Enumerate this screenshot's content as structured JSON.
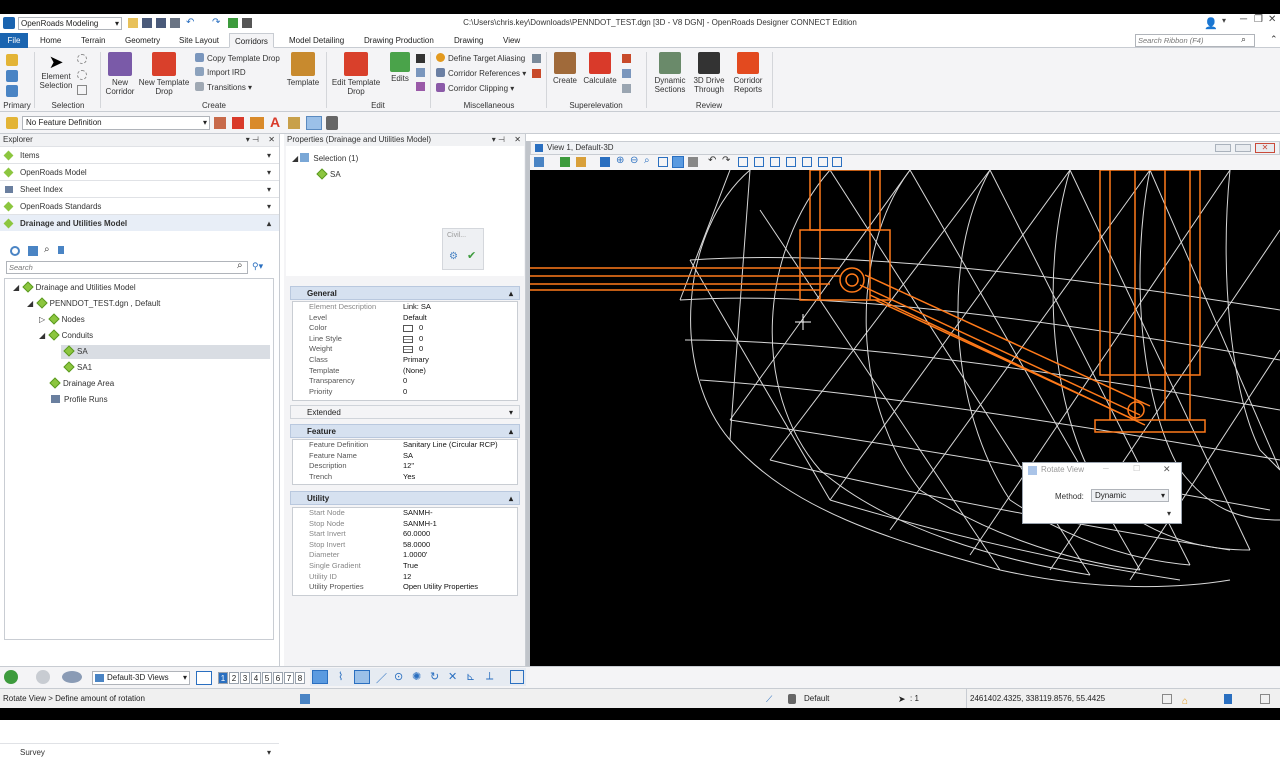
{
  "app": {
    "title": "C:\\Users\\chris.key\\Downloads\\PENNDOT_TEST.dgn [3D - V8 DGN] - OpenRoads Designer CONNECT Edition",
    "workflow": "OpenRoads Modeling",
    "search_placeholder": "Search Ribbon (F4)"
  },
  "tabs": [
    "File",
    "Home",
    "Terrain",
    "Geometry",
    "Site Layout",
    "Corridors",
    "Model Detailing",
    "Drawing Production",
    "Drawing",
    "View"
  ],
  "ribbon": {
    "primary_label": "Primary",
    "selection_label": "Selection",
    "element_selection": "Element Selection",
    "create_label": "Create",
    "new_corridor": "New Corridor",
    "new_template_drop": "New Template Drop",
    "copy_template_drop": "Copy Template Drop",
    "import_ird": "Import IRD",
    "transitions": "Transitions",
    "template": "Template",
    "edit_label": "Edit",
    "edit_template_drop": "Edit Template Drop",
    "edits": "Edits",
    "misc_label": "Miscellaneous",
    "define_target_aliasing": "Define Target Aliasing",
    "corridor_references": "Corridor References",
    "corridor_clipping": "Corridor Clipping",
    "superelevation_label": "Superelevation",
    "se_create": "Create",
    "se_calculate": "Calculate",
    "review_label": "Review",
    "dynamic_sections": "Dynamic Sections",
    "drive_through": "3D Drive Through",
    "corridor_reports": "Corridor Reports"
  },
  "attr": {
    "feature_definition": "No Feature Definition"
  },
  "explorer": {
    "title": "Explorer",
    "sections": [
      "Items",
      "OpenRoads Model",
      "Sheet Index",
      "OpenRoads Standards",
      "Drainage and Utilities Model"
    ],
    "search_placeholder": "Search",
    "tree": [
      "Drainage and Utilities Model",
      "PENNDOT_TEST.dgn , Default",
      "Nodes",
      "Conduits",
      "SA",
      "SA1",
      "Drainage Area",
      "Profile Runs"
    ],
    "survey": "Survey"
  },
  "properties": {
    "title": "Properties (Drainage and Utilities Model)",
    "selection": "Selection (1)",
    "selected": "SA",
    "civil_label": "Civil...",
    "general": {
      "label": "General",
      "rows": [
        [
          "Element Description",
          "Link: SA"
        ],
        [
          "Level",
          "Default"
        ],
        [
          "Color",
          "0"
        ],
        [
          "Line Style",
          "0"
        ],
        [
          "Weight",
          "0"
        ],
        [
          "Class",
          "Primary"
        ],
        [
          "Template",
          "(None)"
        ],
        [
          "Transparency",
          "0"
        ],
        [
          "Priority",
          "0"
        ]
      ]
    },
    "extended": "Extended",
    "feature": {
      "label": "Feature",
      "rows": [
        [
          "Feature Definition",
          "Sanitary Line (Circular RCP)"
        ],
        [
          "Feature Name",
          "SA"
        ],
        [
          "Description",
          "12\""
        ],
        [
          "Trench",
          "Yes"
        ]
      ]
    },
    "utility": {
      "label": "Utility",
      "rows": [
        [
          "Start Node",
          "SANMH-"
        ],
        [
          "Stop Node",
          "SANMH-1"
        ],
        [
          "Start Invert",
          "60.0000"
        ],
        [
          "Stop Invert",
          "58.0000"
        ],
        [
          "Diameter",
          "1.0000'"
        ],
        [
          "Single Gradient",
          "True"
        ],
        [
          "Utility ID",
          "12"
        ],
        [
          "Utility Properties",
          "Open Utility Properties"
        ]
      ]
    }
  },
  "view": {
    "title": "View 1, Default-3D",
    "rotate_title": "Rotate View",
    "method_label": "Method:",
    "method_value": "Dynamic"
  },
  "bottom": {
    "views": "Default-3D Views",
    "nums": [
      "1",
      "2",
      "3",
      "4",
      "5",
      "6",
      "7",
      "8"
    ]
  },
  "status": {
    "prompt": "Rotate View > Define amount of rotation",
    "level": "Default",
    "count": ": 1",
    "coords": "2461402.4325, 338119.8576, 55.4425"
  },
  "colors": {
    "accent": "#1a64b0",
    "pipe": "#ff7a1a",
    "mesh": "#d8d8d8"
  }
}
